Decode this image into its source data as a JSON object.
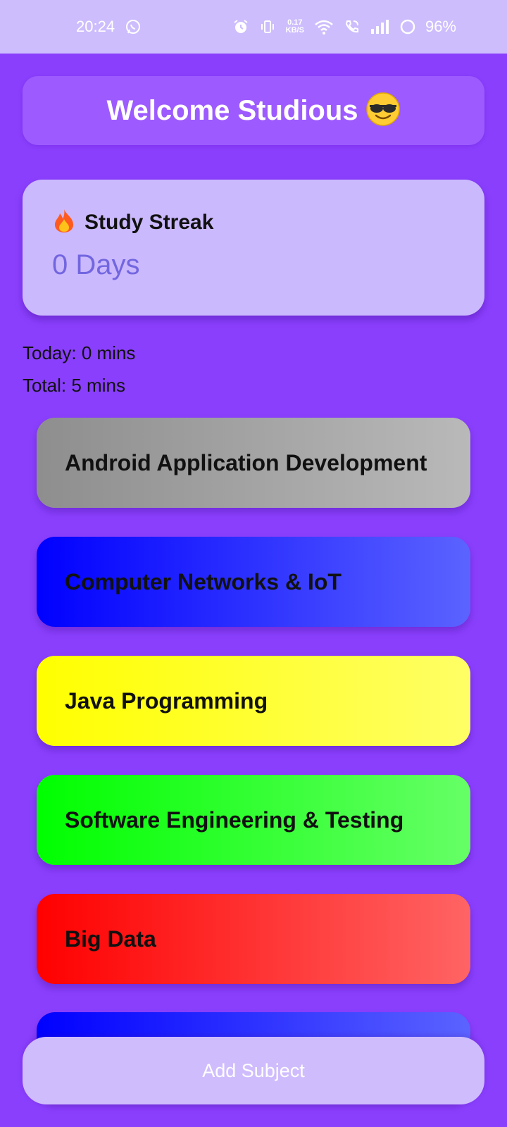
{
  "status_bar": {
    "time": "20:24",
    "net_speed_value": "0.17",
    "net_speed_unit": "KB/S",
    "battery": "96%",
    "icons": [
      "whatsapp-icon",
      "alarm-icon",
      "vibrate-icon",
      "wifi-icon",
      "wifi-call-icon",
      "signal-icon",
      "battery-icon"
    ]
  },
  "welcome": {
    "text": "Welcome Studious"
  },
  "streak": {
    "title": "Study Streak",
    "value": "0 Days"
  },
  "stats": {
    "today": "Today: 0 mins",
    "total": "Total: 5 mins"
  },
  "subjects": [
    {
      "label": "Android Application Development",
      "color_from": "#8e8e8e",
      "color_to": "#b9b9b9"
    },
    {
      "label": "Computer Networks & IoT",
      "color_from": "#0000ff",
      "color_to": "#5b63ff"
    },
    {
      "label": "Java Programming",
      "color_from": "#ffff00",
      "color_to": "#ffff66"
    },
    {
      "label": "Software Engineering & Testing",
      "color_from": "#00ff00",
      "color_to": "#66ff66"
    },
    {
      "label": "Big Data",
      "color_from": "#ff0000",
      "color_to": "#ff6464"
    },
    {
      "label": "",
      "color_from": "#0000ff",
      "color_to": "#5b63ff"
    }
  ],
  "add_button": {
    "label": "Add Subject"
  },
  "colors": {
    "background": "#8a3ffc",
    "card": "#cbb9fd",
    "banner": "#9d5bff",
    "streak_value": "#7266e0"
  }
}
